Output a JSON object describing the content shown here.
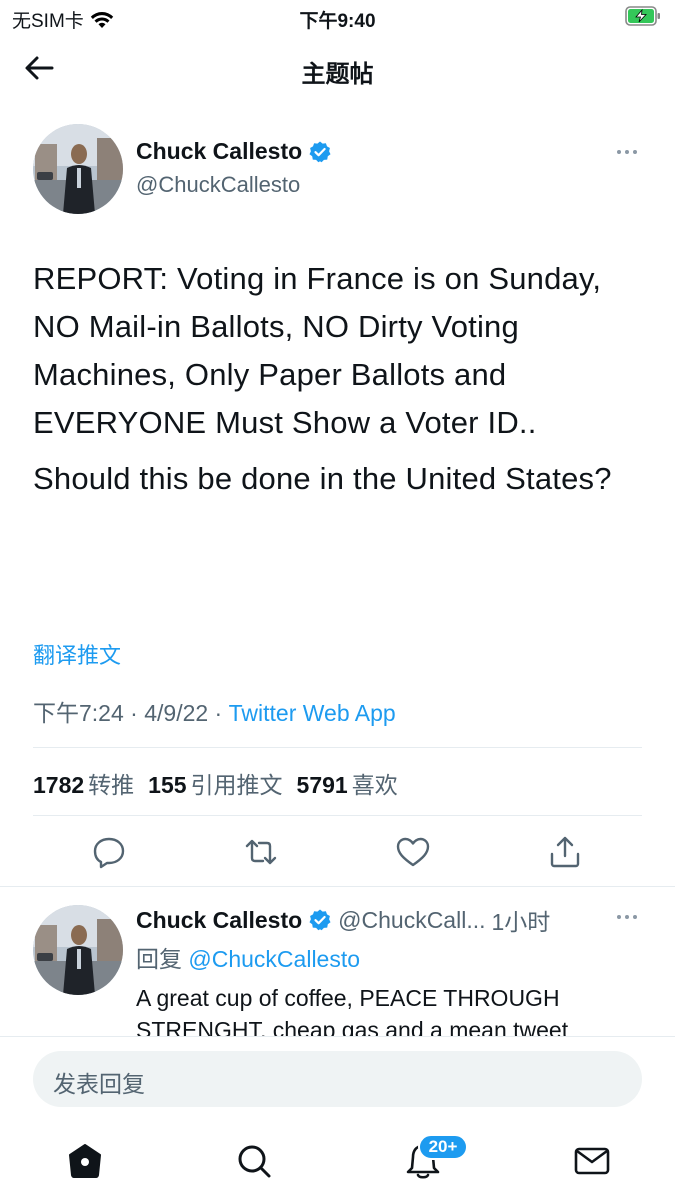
{
  "status_bar": {
    "carrier": "无SIM卡",
    "time": "下午9:40"
  },
  "nav": {
    "title": "主题帖"
  },
  "tweet": {
    "author_name": "Chuck Callesto",
    "author_handle": "@ChuckCallesto",
    "paragraphs": [
      "REPORT: Voting in France is on Sunday, NO Mail-in Ballots, NO Dirty Voting Machines, Only Paper Ballots and EVERYONE Must Show a Voter ID..",
      "Should this be done in the United States?"
    ],
    "translate_label": "翻译推文",
    "time": "下午7:24",
    "date": "4/9/22",
    "source": "Twitter Web App",
    "stats": {
      "retweets_count": "1782",
      "retweets_label": "转推",
      "quotes_count": "155",
      "quotes_label": "引用推文",
      "likes_count": "5791",
      "likes_label": "喜欢"
    }
  },
  "reply": {
    "author_name": "Chuck Callesto",
    "author_handle": "@ChuckCall...",
    "time": "1小时",
    "reply_prefix": "回复",
    "reply_to": "@ChuckCallesto",
    "text": "A great cup of coffee, PEACE THROUGH STRENGHT, cheap gas and a mean tweet"
  },
  "compose": {
    "placeholder": "发表回复"
  },
  "tabbar": {
    "notifications_badge": "20+"
  },
  "colors": {
    "accent": "#1d9bf0",
    "text": "#0f1419",
    "secondary": "#536471",
    "verified": "#1d9bf0"
  }
}
